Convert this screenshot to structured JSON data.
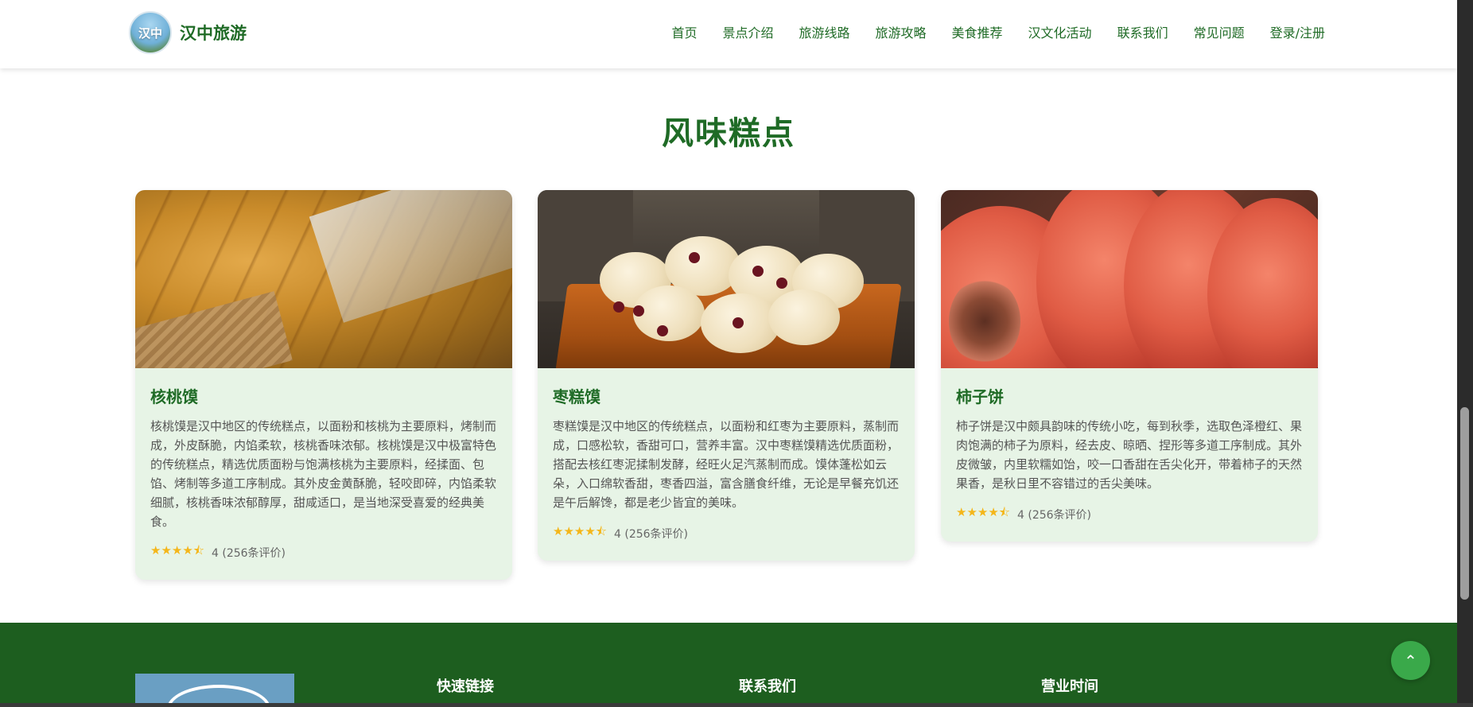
{
  "brand": {
    "logo_text": "汉中",
    "name": "汉中旅游"
  },
  "nav": {
    "items": [
      "首页",
      "景点介绍",
      "旅游线路",
      "旅游攻略",
      "美食推荐",
      "汉文化活动",
      "联系我们",
      "常见问题",
      "登录/注册"
    ]
  },
  "section": {
    "title": "风味糕点"
  },
  "cards": [
    {
      "title": "核桃馍",
      "desc": "核桃馍是汉中地区的传统糕点，以面粉和核桃为主要原料，烤制而成，外皮酥脆，内馅柔软，核桃香味浓郁。核桃馍是汉中极富特色的传统糕点，精选优质面粉与饱满核桃为主要原料，经揉面、包馅、烤制等多道工序制成。其外皮金黄酥脆，轻咬即碎，内馅柔软细腻，核桃香味浓郁醇厚，甜咸适口，是当地深受喜爱的经典美食。",
      "stars": "★★★★",
      "rating_value": 4,
      "rating_text": "4 (256条评价)"
    },
    {
      "title": "枣糕馍",
      "desc": "枣糕馍是汉中地区的传统糕点，以面粉和红枣为主要原料，蒸制而成，口感松软，香甜可口，营养丰富。汉中枣糕馍精选优质面粉，搭配去核红枣泥揉制发酵，经旺火足汽蒸制而成。馍体蓬松如云朵，入口绵软香甜，枣香四溢，富含膳食纤维，无论是早餐充饥还是午后解馋，都是老少皆宜的美味。",
      "stars": "★★★★",
      "rating_value": 4,
      "rating_text": "4 (256条评价)"
    },
    {
      "title": "柿子饼",
      "desc": "柿子饼是汉中颇具韵味的传统小吃，每到秋季，选取色泽橙红、果肉饱满的柿子为原料，经去皮、晾晒、捏形等多道工序制成。其外皮微皱，内里软糯如饴，咬一口香甜在舌尖化开，带着柿子的天然果香，是秋日里不容错过的舌尖美味。",
      "stars": "★★★★",
      "rating_value": 4,
      "rating_text": "4 (256条评价)"
    }
  ],
  "footer": {
    "col1": "快速链接",
    "col2": "联系我们",
    "col3": "营业时间"
  },
  "colors": {
    "brand_green": "#1f6b26",
    "card_bg": "#e7f4e6",
    "footer_bg": "#1d5e1f",
    "star": "#f4b61a",
    "back_top": "#3aa94a"
  },
  "icons": {
    "back_top": "chevron-up-icon",
    "star": "star-icon"
  }
}
